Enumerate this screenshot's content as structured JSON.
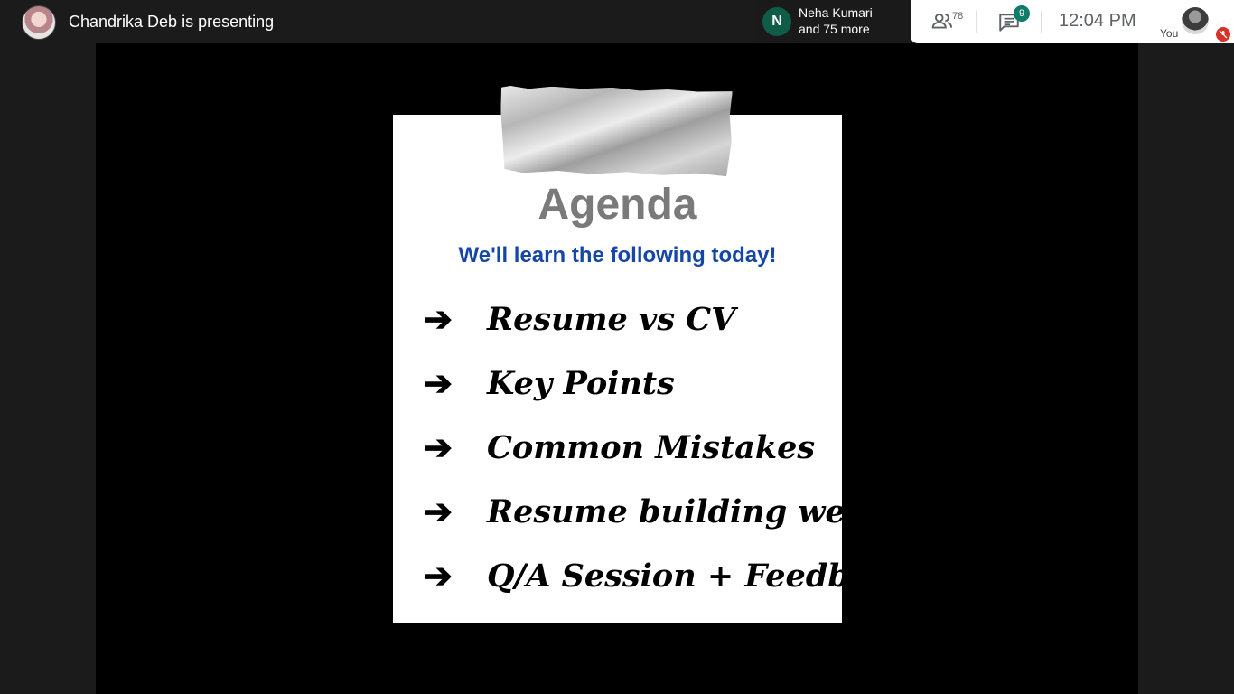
{
  "topbar": {
    "presenter_text": "Chandrika Deb is presenting",
    "participants_chip": {
      "initial": "N",
      "name": "Neha Kumari",
      "more": "and 75 more",
      "avatar_color": "#0f5c49"
    },
    "people_count": "78",
    "chat_badge": "9",
    "chat_badge_color": "#0f7c67",
    "clock": "12:04  PM",
    "self_label": "You",
    "mute_color": "#d93025"
  },
  "slide": {
    "title": "Agenda",
    "subtitle": "We'll learn the following today!",
    "subtitle_color": "#1747a6",
    "items": [
      {
        "arrow": "➔",
        "text": "Resume vs CV"
      },
      {
        "arrow": "➔",
        "text": "Key Points"
      },
      {
        "arrow": "➔",
        "text": "Common Mistakes"
      },
      {
        "arrow": "➔",
        "text": "Resume building websites"
      },
      {
        "arrow": "➔",
        "text": "Q/A Session + Feedbacks"
      }
    ]
  }
}
